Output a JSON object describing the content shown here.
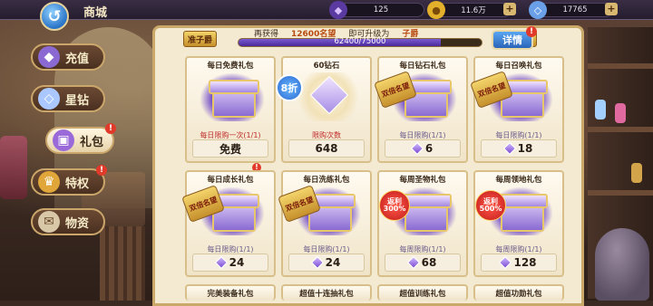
{
  "header": {
    "title": "商城",
    "resources": [
      {
        "icon": "purple-crystal-icon",
        "value": "125"
      },
      {
        "icon": "gold-coin-icon",
        "value": "11.6万"
      },
      {
        "icon": "diamond-icon",
        "value": "17765"
      }
    ]
  },
  "sidebar": {
    "items": [
      {
        "label": "充值",
        "icon": "gem-icon"
      },
      {
        "label": "星钻",
        "icon": "diamond-icon"
      },
      {
        "label": "礼包",
        "icon": "gift-icon",
        "active": true,
        "badge": "!"
      },
      {
        "label": "特权",
        "icon": "crown-icon",
        "badge": "!"
      },
      {
        "label": "物资",
        "icon": "scroll-icon"
      }
    ]
  },
  "progress": {
    "rank_current": "准子爵",
    "rank_next": "子爵",
    "gained_label": "再获得",
    "gained_value": "12600名望",
    "upgrade_label": "即可升级为",
    "upgrade_target": "子爵",
    "bar_text": "62400/75000",
    "fraction": 0.832,
    "detail_label": "详情",
    "detail_badge": "!"
  },
  "cards": [
    {
      "title": "每日免费礼包",
      "limit": "每日限购一次(1/1)",
      "price": "免费",
      "badge": "",
      "alert": "!"
    },
    {
      "title": "60钻石",
      "limit": "限购次数",
      "price": "648",
      "badge": "8折"
    },
    {
      "title": "每日钻石礼包",
      "limit": "每日限购(1/1)",
      "price": "6",
      "badge": "双倍名望",
      "price_icon": true
    },
    {
      "title": "每日召唤礼包",
      "limit": "每日限购(1/1)",
      "price": "18",
      "badge": "双倍名望",
      "price_icon": true
    },
    {
      "title": "每日成长礼包",
      "limit": "每日限购(1/1)",
      "price": "24",
      "badge": "双倍名望",
      "price_icon": true
    },
    {
      "title": "每日洗练礼包",
      "limit": "每日限购(1/1)",
      "price": "24",
      "badge": "双倍名望",
      "price_icon": true
    },
    {
      "title": "每周圣物礼包",
      "limit": "每周限购(1/1)",
      "price": "68",
      "badge_top": "返利",
      "badge_bottom": "300%",
      "price_icon": true
    },
    {
      "title": "每周领地礼包",
      "limit": "每周限购(1/1)",
      "price": "128",
      "badge_top": "返利",
      "badge_bottom": "500%",
      "price_icon": true
    }
  ],
  "next_row": [
    "完美装备礼包",
    "超值十连抽礼包",
    "超值训练礼包",
    "超值功勋礼包"
  ],
  "colors": {
    "accent_gold": "#c9a869",
    "panel_bg": "#f4ead2",
    "alert_red": "#e23a2a"
  }
}
